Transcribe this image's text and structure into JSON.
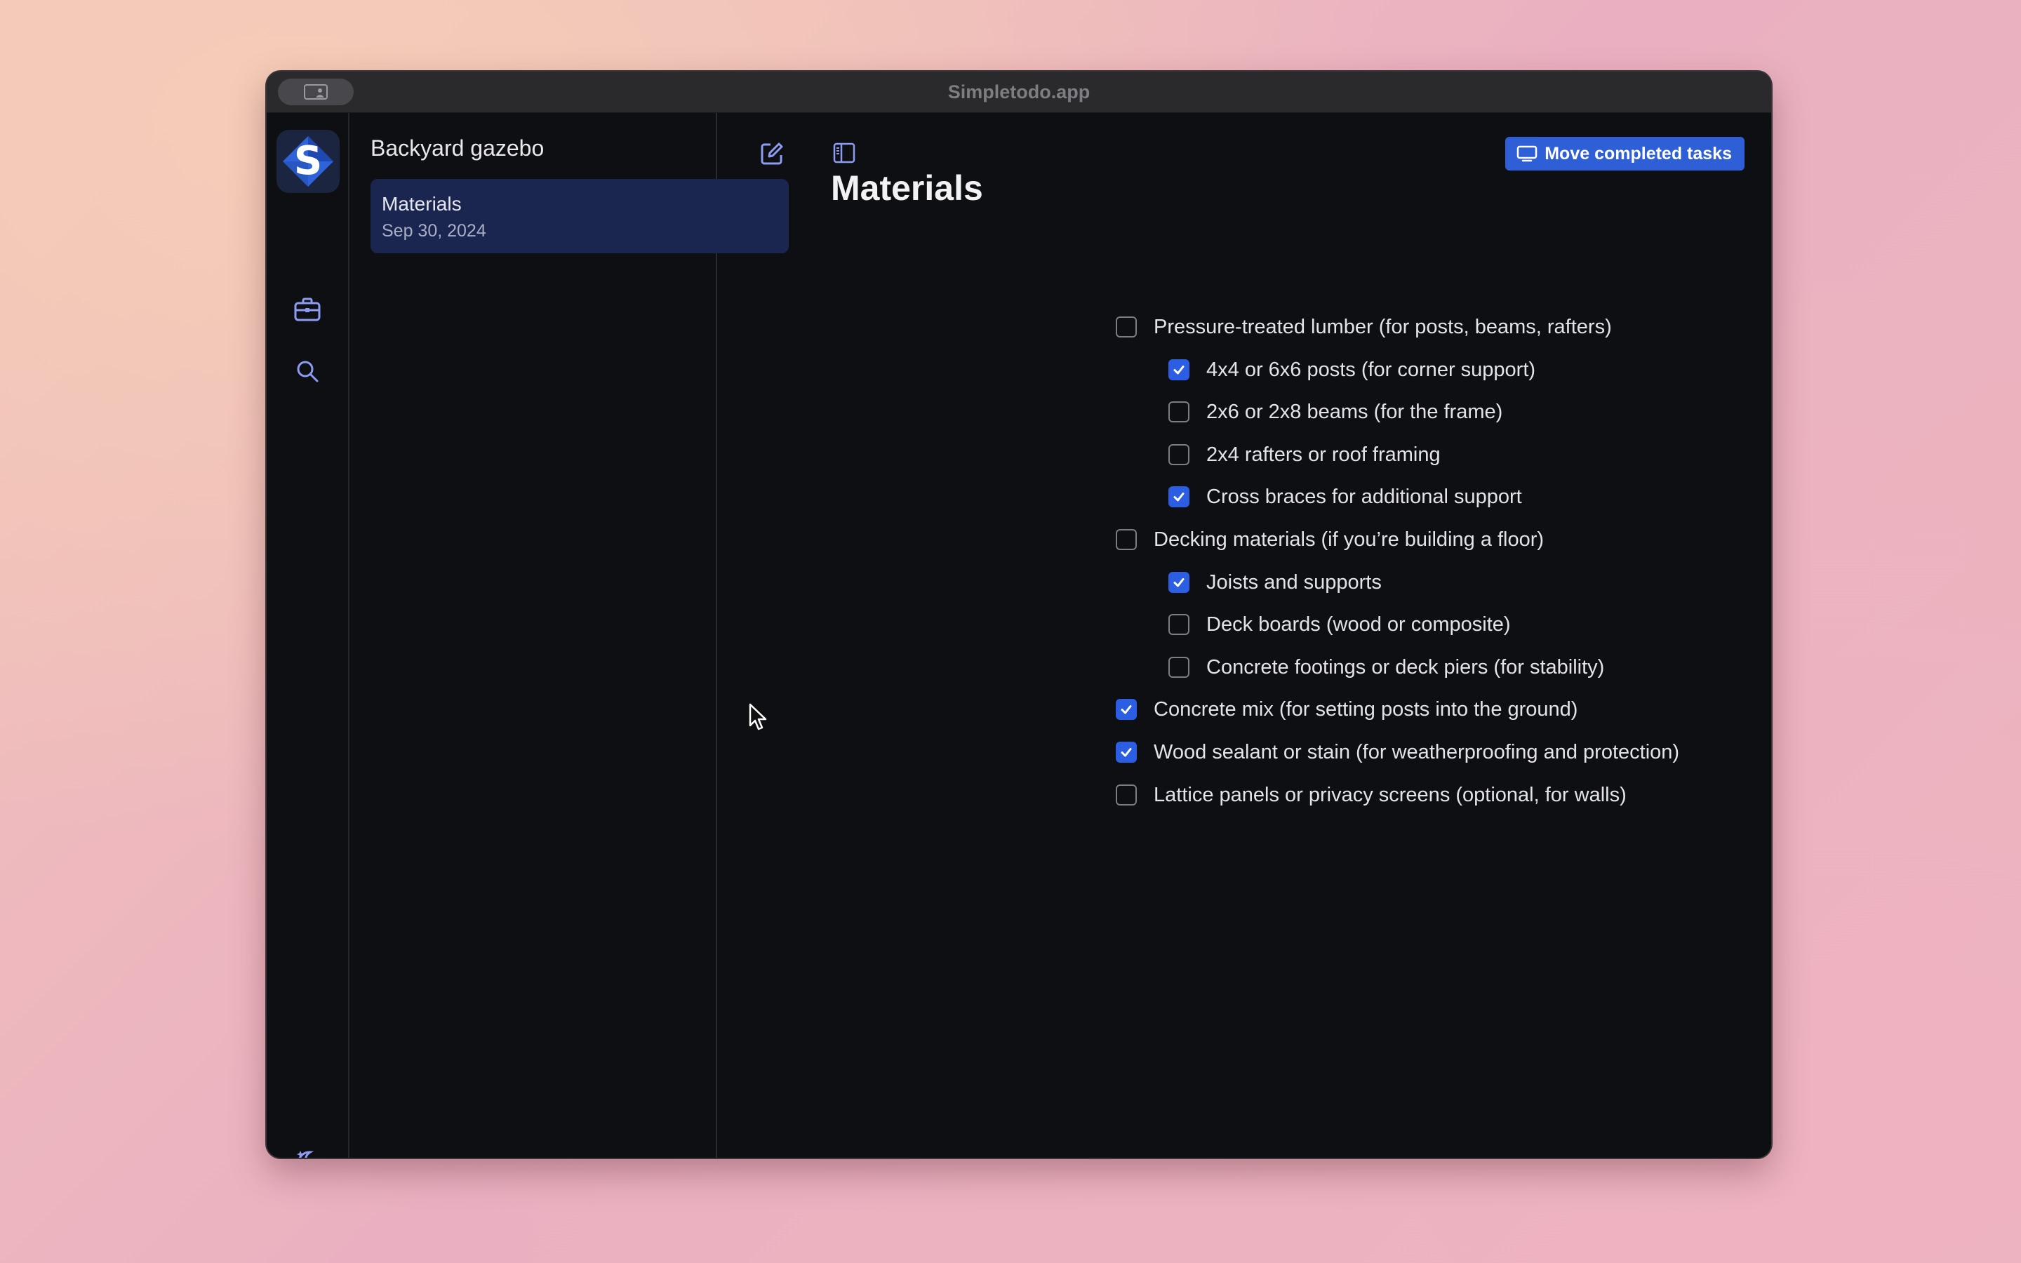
{
  "window": {
    "title": "Simpletodo.app"
  },
  "rail": {
    "logo_letter": "S",
    "icons": [
      "briefcase-icon",
      "search-icon",
      "moon-stars-icon"
    ]
  },
  "list": {
    "title": "Backyard gazebo",
    "items": [
      {
        "title": "Materials",
        "date": "Sep 30, 2024"
      }
    ]
  },
  "main": {
    "title": "Materials",
    "move_button_label": "Move completed tasks",
    "tasks": [
      {
        "label": "Pressure-treated lumber (for posts, beams, rafters)",
        "checked": false,
        "level": 0
      },
      {
        "label": "4x4 or 6x6 posts (for corner support)",
        "checked": true,
        "level": 1
      },
      {
        "label": "2x6 or 2x8 beams (for the frame)",
        "checked": false,
        "level": 1
      },
      {
        "label": "2x4 rafters or roof framing",
        "checked": false,
        "level": 1
      },
      {
        "label": "Cross braces for additional support",
        "checked": true,
        "level": 1
      },
      {
        "label": "Decking materials (if you’re building a floor)",
        "checked": false,
        "level": 0
      },
      {
        "label": "Joists and supports",
        "checked": true,
        "level": 1
      },
      {
        "label": "Deck boards (wood or composite)",
        "checked": false,
        "level": 1
      },
      {
        "label": "Concrete footings or deck piers (for stability)",
        "checked": false,
        "level": 1
      },
      {
        "label": "Concrete mix (for setting posts into the ground)",
        "checked": true,
        "level": 0
      },
      {
        "label": "Wood sealant or stain (for weatherproofing and protection)",
        "checked": true,
        "level": 0
      },
      {
        "label": "Lattice panels or privacy screens (optional, for walls)",
        "checked": false,
        "level": 0
      }
    ]
  },
  "colors": {
    "accent": "#2c5ee3",
    "button": "#2f5fd6",
    "selected_item": "#1a2550"
  }
}
